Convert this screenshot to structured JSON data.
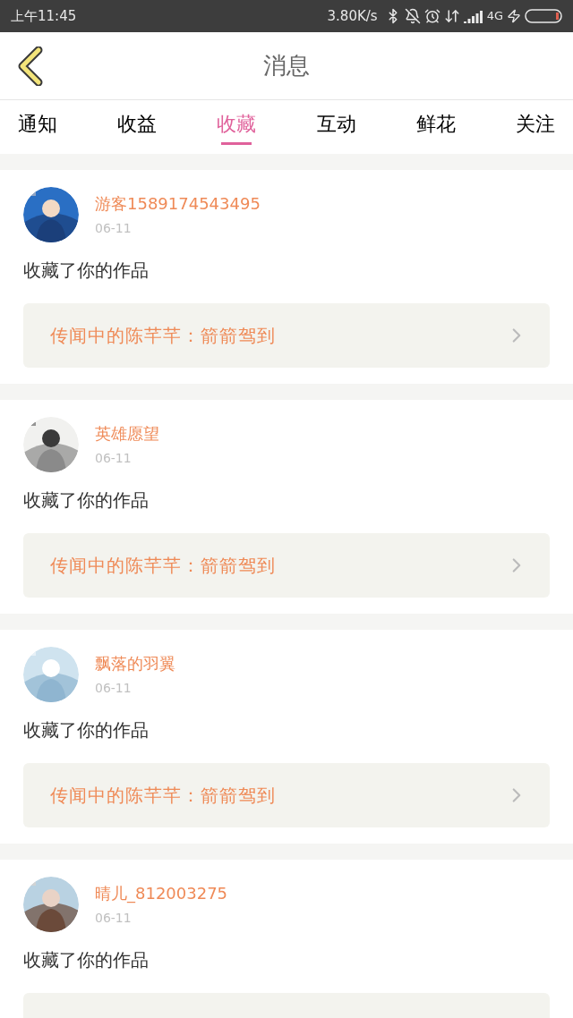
{
  "status_bar": {
    "time": "上午11:45",
    "speed": "3.80K/s",
    "network": "4G"
  },
  "header": {
    "title": "消息"
  },
  "tabs": [
    {
      "label": "通知",
      "selected": false
    },
    {
      "label": "收益",
      "selected": false
    },
    {
      "label": "收藏",
      "selected": true
    },
    {
      "label": "互动",
      "selected": false
    },
    {
      "label": "鲜花",
      "selected": false
    },
    {
      "label": "关注",
      "selected": false
    }
  ],
  "messages": [
    {
      "user": "游客1589174543495",
      "date": "06-11",
      "text": "收藏了你的作品",
      "work": "传闻中的陈芊芊：箭箭驾到"
    },
    {
      "user": "英雄愿望",
      "date": "06-11",
      "text": "收藏了你的作品",
      "work": "传闻中的陈芊芊：箭箭驾到"
    },
    {
      "user": "飘落的羽翼",
      "date": "06-11",
      "text": "收藏了你的作品",
      "work": "传闻中的陈芊芊：箭箭驾到"
    },
    {
      "user": "晴儿_812003275",
      "date": "06-11",
      "text": "收藏了你的作品"
    }
  ]
}
